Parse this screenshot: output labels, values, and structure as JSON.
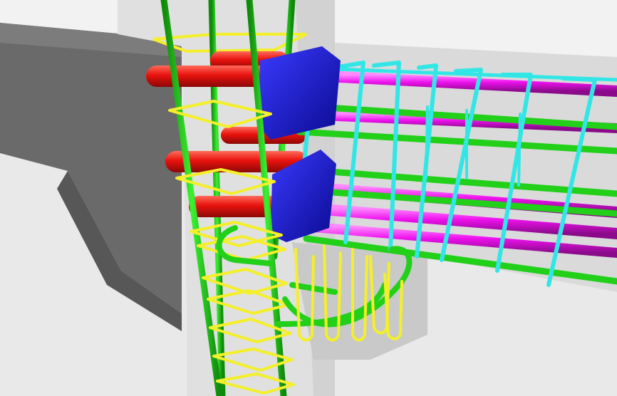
{
  "viewport": {
    "description_free": true
  },
  "palette": {
    "background": "#f2f2f2",
    "concrete_light": "#dcdcdc",
    "concrete_mid": "#c8c8c8",
    "concrete_dark": "#6e6e6e",
    "concrete_darker": "#5a5a5a",
    "column_face": "#e6e6e6",
    "stirrup_yellow": "#f4ef2a",
    "bar_green": "#22d01a",
    "bar_red": "#e8120e",
    "bar_magenta": "#ee11ee",
    "stirrup_cyan": "#33e6e6",
    "anchor_blue": "#1111dd"
  },
  "elements": [
    {
      "kind": "column-vertical-bars",
      "color": "green",
      "count": 4
    },
    {
      "kind": "column-stirrups",
      "color": "yellow",
      "count": 12
    },
    {
      "kind": "transverse-bars",
      "color": "red",
      "count": 5
    },
    {
      "kind": "beam-longitudinal-bars",
      "color": "magenta",
      "count": 5
    },
    {
      "kind": "beam-longitudinal-bars",
      "color": "green",
      "count": 4
    },
    {
      "kind": "beam-stirrups",
      "color": "cyan",
      "count": 7
    },
    {
      "kind": "anchor-plates",
      "color": "blue",
      "count": 2
    },
    {
      "kind": "u-hooks",
      "color": "yellow",
      "count": 5
    }
  ]
}
